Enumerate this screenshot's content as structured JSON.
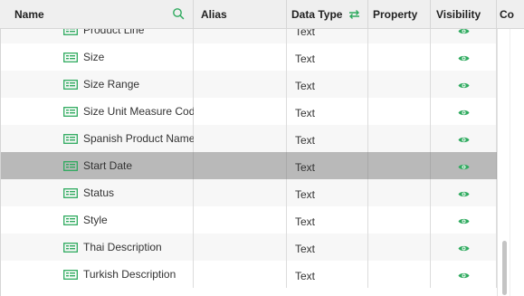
{
  "header": {
    "name_label": "Name",
    "alias_label": "Alias",
    "data_type_label": "Data Type",
    "property_label": "Property",
    "visibility_label": "Visibility",
    "col_label": "Co"
  },
  "icons": {
    "search": "search-icon",
    "swap": "swap-icon",
    "field": "text-field-icon",
    "visibility": "eye-icon"
  },
  "colors": {
    "accent": "#2eaa5e",
    "header_bg": "#efefef",
    "selected_row": "#b9b9b9"
  },
  "rows": [
    {
      "name": "Product Line",
      "alias": "",
      "type": "Text",
      "property": ""
    },
    {
      "name": "Size",
      "alias": "",
      "type": "Text",
      "property": ""
    },
    {
      "name": "Size Range",
      "alias": "",
      "type": "Text",
      "property": ""
    },
    {
      "name": "Size Unit Measure Code",
      "alias": "",
      "type": "Text",
      "property": ""
    },
    {
      "name": "Spanish Product Name",
      "alias": "",
      "type": "Text",
      "property": ""
    },
    {
      "name": "Start Date",
      "alias": "",
      "type": "Text",
      "property": "",
      "selected": true
    },
    {
      "name": "Status",
      "alias": "",
      "type": "Text",
      "property": ""
    },
    {
      "name": "Style",
      "alias": "",
      "type": "Text",
      "property": ""
    },
    {
      "name": "Thai Description",
      "alias": "",
      "type": "Text",
      "property": ""
    },
    {
      "name": "Turkish Description",
      "alias": "",
      "type": "Text",
      "property": ""
    }
  ]
}
